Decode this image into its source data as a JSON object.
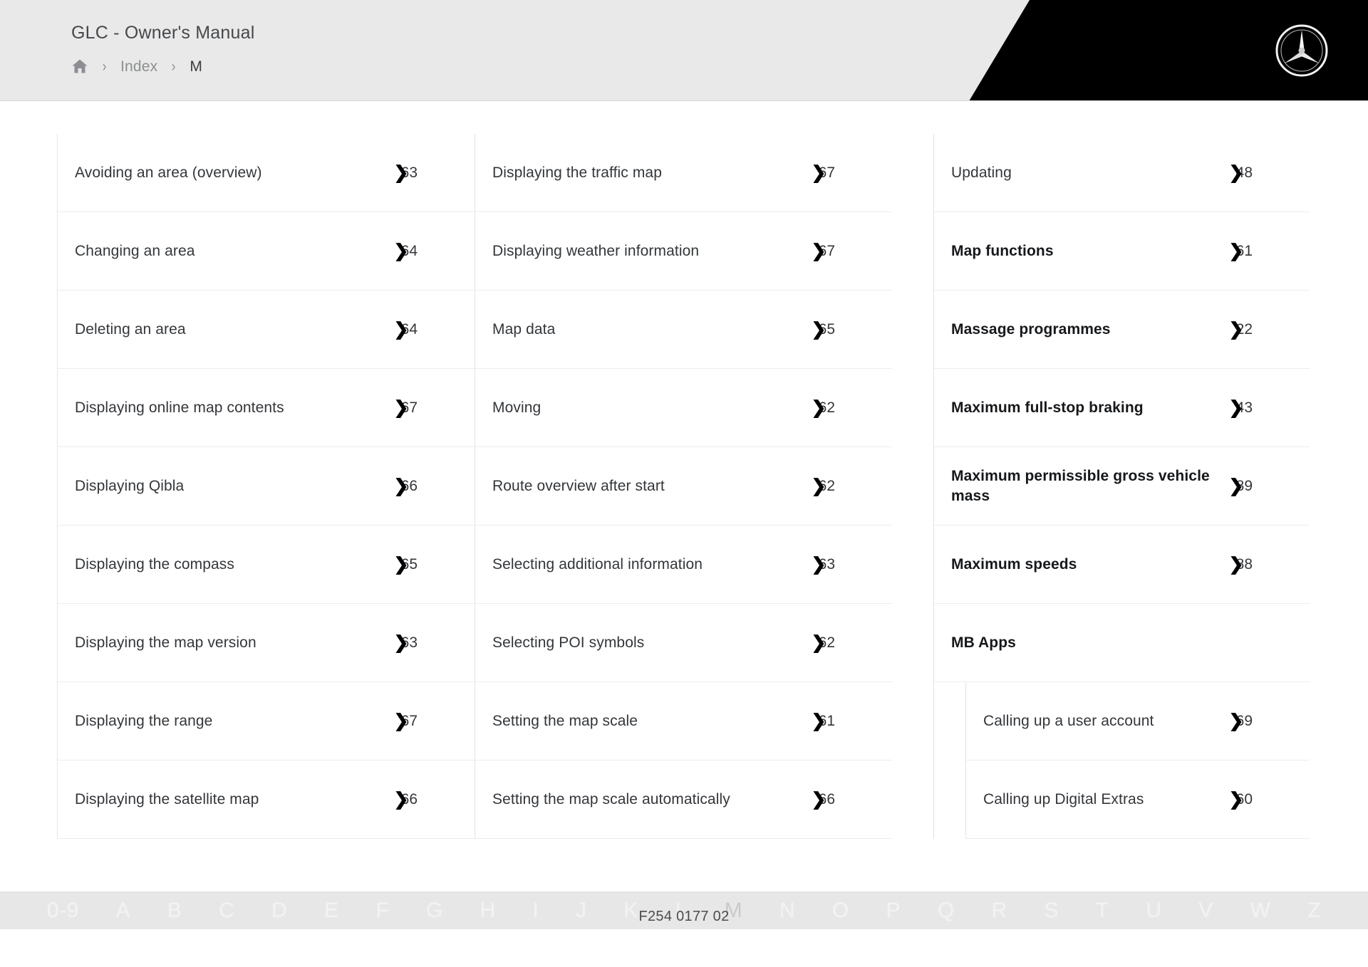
{
  "header": {
    "manual_title": "GLC - Owner's Manual",
    "breadcrumb": {
      "home_icon": "home-icon",
      "separator": "›",
      "index_label": "Index",
      "current_label": "M"
    },
    "logo": "mercedes-star-icon"
  },
  "columns": [
    {
      "id": "column-1",
      "entries": [
        {
          "label": "Avoiding an area (overview)",
          "page_prefix": "6",
          "page_suffix": "3",
          "bold": false
        },
        {
          "label": "Changing an area",
          "page_prefix": "6",
          "page_suffix": "4",
          "bold": false
        },
        {
          "label": "Deleting an area",
          "page_prefix": "6",
          "page_suffix": "4",
          "bold": false
        },
        {
          "label": "Displaying online map contents",
          "page_prefix": "6",
          "page_suffix": "7",
          "bold": false
        },
        {
          "label": "Displaying Qibla",
          "page_prefix": "6",
          "page_suffix": "6",
          "bold": false
        },
        {
          "label": "Displaying the compass",
          "page_prefix": "6",
          "page_suffix": "5",
          "bold": false
        },
        {
          "label": "Displaying the map version",
          "page_prefix": "6",
          "page_suffix": "3",
          "bold": false
        },
        {
          "label": "Displaying the range",
          "page_prefix": "6",
          "page_suffix": "7",
          "bold": false
        },
        {
          "label": "Displaying the satellite map",
          "page_prefix": "6",
          "page_suffix": "6",
          "bold": false
        }
      ]
    },
    {
      "id": "column-2",
      "entries": [
        {
          "label": "Displaying the traffic map",
          "page_prefix": "6",
          "page_suffix": "7",
          "bold": false
        },
        {
          "label": "Displaying weather information",
          "page_prefix": "6",
          "page_suffix": "7",
          "bold": false
        },
        {
          "label": "Map data",
          "page_prefix": "6",
          "page_suffix": "5",
          "bold": false
        },
        {
          "label": "Moving",
          "page_prefix": "6",
          "page_suffix": "2",
          "bold": false
        },
        {
          "label": "Route overview after start",
          "page_prefix": "6",
          "page_suffix": "2",
          "bold": false
        },
        {
          "label": "Selecting additional information",
          "page_prefix": "6",
          "page_suffix": "3",
          "bold": false
        },
        {
          "label": "Selecting POI symbols",
          "page_prefix": "6",
          "page_suffix": "2",
          "bold": false
        },
        {
          "label": "Setting the map scale",
          "page_prefix": "6",
          "page_suffix": "1",
          "bold": false
        },
        {
          "label": "Setting the map scale automatically",
          "page_prefix": "6",
          "page_suffix": "6",
          "bold": false
        }
      ]
    },
    {
      "id": "column-3",
      "entries": [
        {
          "label": "Updating",
          "page_prefix": "4",
          "page_suffix": "8",
          "bold": false,
          "indented": true
        },
        {
          "label": "Map functions",
          "page_prefix": "6",
          "page_suffix": "1",
          "bold": true
        },
        {
          "label": "Massage programmes",
          "page_prefix": "2",
          "page_suffix": "2",
          "bold": true
        },
        {
          "label": "Maximum full-stop braking",
          "page_prefix": "4",
          "page_suffix": "3",
          "bold": true
        },
        {
          "label": "Maximum permissible gross vehicle mass",
          "page_prefix": "8",
          "page_suffix": "9",
          "bold": true
        },
        {
          "label": "Maximum speeds",
          "page_prefix": "8",
          "page_suffix": "8",
          "bold": true
        },
        {
          "label": "MB Apps",
          "page_prefix": "",
          "page_suffix": "",
          "bold": true,
          "group": true
        },
        {
          "label": "Calling up a user account",
          "page_prefix": "6",
          "page_suffix": "9",
          "bold": false,
          "indented": true
        },
        {
          "label": "Calling up Digital Extras",
          "page_prefix": "6",
          "page_suffix": "0",
          "bold": false,
          "indented": true
        }
      ]
    }
  ],
  "alphabet_bar": {
    "items": [
      "0-9",
      "A",
      "B",
      "C",
      "D",
      "E",
      "F",
      "G",
      "H",
      "I",
      "J",
      "K",
      "L",
      "M",
      "N",
      "O",
      "P",
      "Q",
      "R",
      "S",
      "T",
      "U",
      "V",
      "W",
      "Z"
    ],
    "active": "M"
  },
  "footer": {
    "doc_code": "F254 0177 02"
  },
  "colors": {
    "header_bg": "#e9e9e9",
    "header_accent": "#000000",
    "text": "#33363a",
    "muted": "#8c8e91",
    "alpha_bg": "#e7e7e7"
  }
}
